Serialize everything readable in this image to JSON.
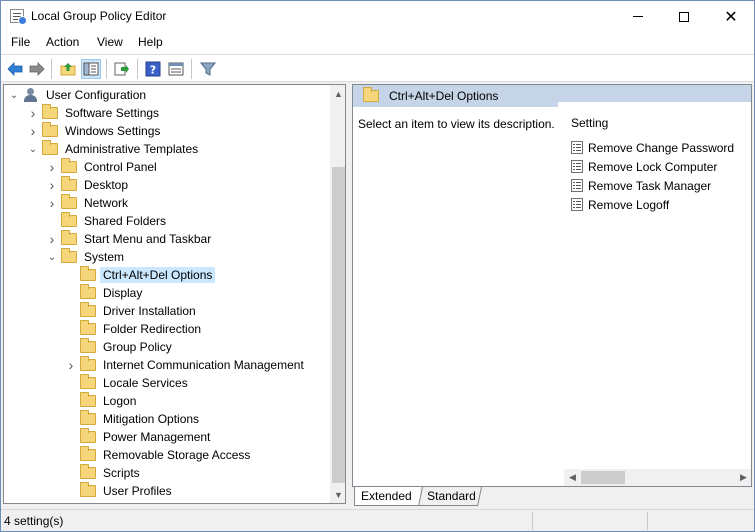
{
  "window": {
    "title": "Local Group Policy Editor"
  },
  "menu": [
    "File",
    "Action",
    "View",
    "Help"
  ],
  "toolbar": {
    "icons": [
      "back-icon",
      "forward-icon",
      "up-folder-icon",
      "show-hide-tree-icon",
      "export-list-icon",
      "help-icon",
      "properties-icon",
      "filter-icon"
    ],
    "active": "show-hide-tree-icon"
  },
  "tree": [
    {
      "label": "User Configuration",
      "depth": 0,
      "expander": "open",
      "icon": "user-config-icon"
    },
    {
      "label": "Software Settings",
      "depth": 1,
      "expander": "closed",
      "icon": "folder-icon"
    },
    {
      "label": "Windows Settings",
      "depth": 1,
      "expander": "closed",
      "icon": "folder-icon"
    },
    {
      "label": "Administrative Templates",
      "depth": 1,
      "expander": "open",
      "icon": "folder-icon"
    },
    {
      "label": "Control Panel",
      "depth": 2,
      "expander": "closed",
      "icon": "folder-icon"
    },
    {
      "label": "Desktop",
      "depth": 2,
      "expander": "closed",
      "icon": "folder-icon"
    },
    {
      "label": "Network",
      "depth": 2,
      "expander": "closed",
      "icon": "folder-icon"
    },
    {
      "label": "Shared Folders",
      "depth": 2,
      "expander": "none",
      "icon": "folder-icon"
    },
    {
      "label": "Start Menu and Taskbar",
      "depth": 2,
      "expander": "closed",
      "icon": "folder-icon"
    },
    {
      "label": "System",
      "depth": 2,
      "expander": "open",
      "icon": "folder-icon"
    },
    {
      "label": "Ctrl+Alt+Del Options",
      "depth": 3,
      "expander": "none",
      "icon": "folder-icon",
      "selected": true
    },
    {
      "label": "Display",
      "depth": 3,
      "expander": "none",
      "icon": "folder-icon"
    },
    {
      "label": "Driver Installation",
      "depth": 3,
      "expander": "none",
      "icon": "folder-icon"
    },
    {
      "label": "Folder Redirection",
      "depth": 3,
      "expander": "none",
      "icon": "folder-icon"
    },
    {
      "label": "Group Policy",
      "depth": 3,
      "expander": "none",
      "icon": "folder-icon"
    },
    {
      "label": "Internet Communication Management",
      "depth": 3,
      "expander": "closed",
      "icon": "folder-icon"
    },
    {
      "label": "Locale Services",
      "depth": 3,
      "expander": "none",
      "icon": "folder-icon"
    },
    {
      "label": "Logon",
      "depth": 3,
      "expander": "none",
      "icon": "folder-icon"
    },
    {
      "label": "Mitigation Options",
      "depth": 3,
      "expander": "none",
      "icon": "folder-icon"
    },
    {
      "label": "Power Management",
      "depth": 3,
      "expander": "none",
      "icon": "folder-icon"
    },
    {
      "label": "Removable Storage Access",
      "depth": 3,
      "expander": "none",
      "icon": "folder-icon"
    },
    {
      "label": "Scripts",
      "depth": 3,
      "expander": "none",
      "icon": "folder-icon"
    },
    {
      "label": "User Profiles",
      "depth": 3,
      "expander": "none",
      "icon": "folder-icon"
    }
  ],
  "right": {
    "header_title": "Ctrl+Alt+Del Options",
    "description": "Select an item to view its description.",
    "column_header": "Setting",
    "settings": [
      "Remove Change Password",
      "Remove Lock Computer",
      "Remove Task Manager",
      "Remove Logoff"
    ]
  },
  "tabs": {
    "extended": "Extended",
    "standard": "Standard"
  },
  "status": {
    "text": "4 setting(s)"
  },
  "colors": {
    "selection": "#cce8ff",
    "header_bar": "#c5d4e6",
    "folder": "#f5d67a"
  }
}
